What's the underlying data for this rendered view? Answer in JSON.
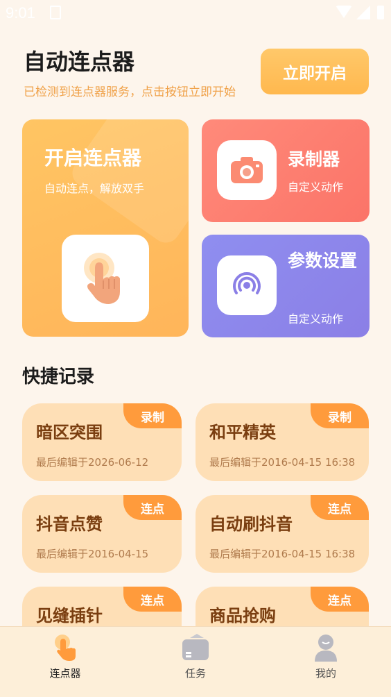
{
  "status_bar": {
    "time": "9:01"
  },
  "header": {
    "title": "自动连点器",
    "subtitle": "已检测到连点器服务，点击按钮立即开始",
    "start_button": "立即开启"
  },
  "cards": {
    "main": {
      "title": "开启连点器",
      "subtitle": "自动连点，解放双手",
      "icon": "hand-tap-icon"
    },
    "recorder": {
      "title": "录制器",
      "subtitle": "自定义动作",
      "icon": "camera-icon"
    },
    "settings": {
      "title": "参数设置",
      "subtitle": "自定义动作",
      "icon": "signal-icon"
    }
  },
  "quick_records": {
    "title": "快捷记录",
    "items": [
      {
        "name": "暗区突围",
        "date": "最后编辑于2026-06-12",
        "tag": "录制"
      },
      {
        "name": "和平精英",
        "date": "最后编辑于2016-04-15 16:38",
        "tag": "录制"
      },
      {
        "name": "抖音点赞",
        "date": "最后编辑于2016-04-15",
        "tag": "连点"
      },
      {
        "name": "自动刷抖音",
        "date": "最后编辑于2016-04-15 16:38",
        "tag": "连点"
      },
      {
        "name": "见缝插针",
        "date": "",
        "tag": "连点"
      },
      {
        "name": "商品抢购",
        "date": "",
        "tag": "连点"
      }
    ]
  },
  "bottom_nav": {
    "items": [
      {
        "label": "连点器",
        "icon": "hand-tap-icon",
        "active": true
      },
      {
        "label": "任务",
        "icon": "task-folder-icon",
        "active": false
      },
      {
        "label": "我的",
        "icon": "user-icon",
        "active": false
      }
    ]
  },
  "colors": {
    "accent_orange": "#ffb84e",
    "card_red": "#fb7468",
    "card_purple": "#8b7fe6",
    "tag_orange": "#ff9b3c",
    "record_bg": "#fedfb6"
  }
}
